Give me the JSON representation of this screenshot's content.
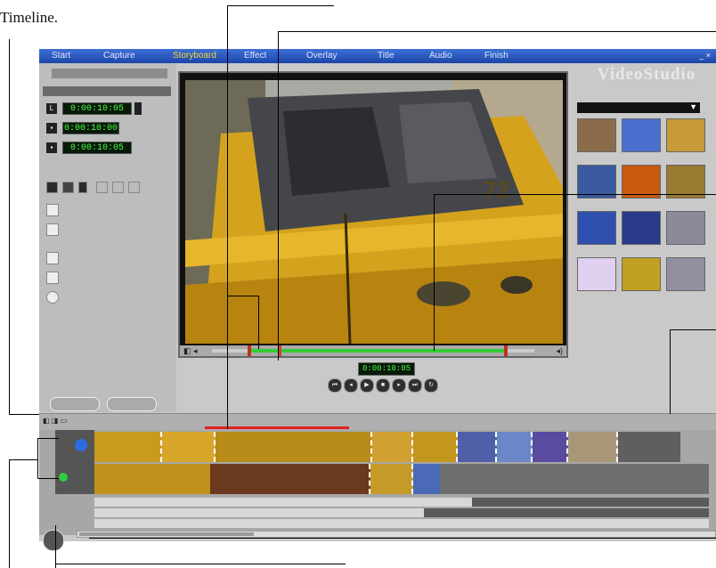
{
  "caption": {
    "line1": "",
    "line2": "Timeline."
  },
  "menubar": {
    "items": [
      "Start",
      "Capture",
      "Storyboard",
      "Effect",
      "Overlay",
      "Title",
      "Audio",
      "Finish"
    ],
    "active_index": 2,
    "window_buttons": "_ ×"
  },
  "left_panel": {
    "title": "",
    "header": "",
    "timecodes": [
      "0:00:10:05",
      "0:00:10:00",
      "0:00:10:05"
    ],
    "options": [
      "",
      "",
      "",
      "",
      ""
    ],
    "buttons": [
      "",
      ""
    ]
  },
  "player": {
    "scrub_start": "",
    "scrub_end": ""
  },
  "transport": {
    "timecode": "0:00:10:05"
  },
  "logo": {
    "text": "VideoStudio"
  },
  "library": {
    "dropdown": "",
    "thumbs": [
      {
        "caption": "",
        "color": "#8b6c4a"
      },
      {
        "caption": "",
        "color": "#4a6fd0"
      },
      {
        "caption": "",
        "color": "#c89a3a"
      },
      {
        "caption": "",
        "color": "#3a5aa0"
      },
      {
        "caption": "",
        "color": "#c85a10"
      },
      {
        "caption": "",
        "color": "#9a7a30"
      },
      {
        "caption": "",
        "color": "#3050b0"
      },
      {
        "caption": "",
        "color": "#2a3a8a"
      },
      {
        "caption": "",
        "color": "#8a8a9a"
      },
      {
        "caption": "",
        "color": "#e0d0f0"
      },
      {
        "caption": "",
        "color": "#c0a020"
      },
      {
        "caption": "",
        "color": "#9090a0"
      }
    ]
  },
  "timeline": {
    "ruler_ticks": [
      "",
      "",
      "",
      "",
      "",
      "",
      "",
      ""
    ],
    "text_rows": [
      "",
      "",
      ""
    ]
  },
  "colors": {
    "accent": "#1c46a8",
    "active_menu": "#f5d832",
    "timecode": "#4cff4c",
    "scrub": "#33cc33"
  }
}
